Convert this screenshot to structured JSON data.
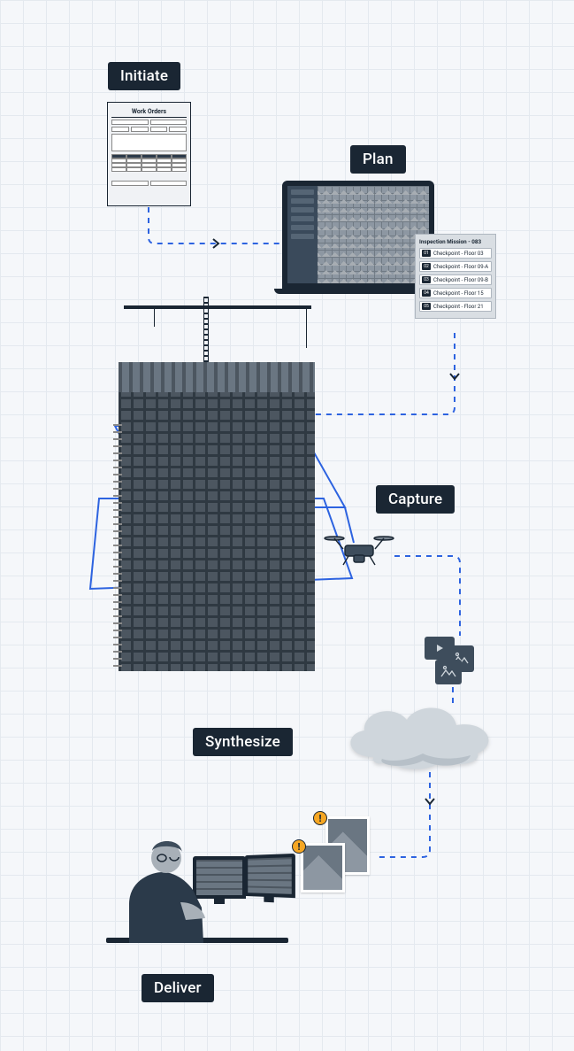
{
  "steps": {
    "initiate": "Initiate",
    "plan": "Plan",
    "capture": "Capture",
    "synthesize": "Synthesize",
    "deliver": "Deliver"
  },
  "workorder": {
    "title": "Work Orders"
  },
  "mission": {
    "title": "Inspection Mission - 083",
    "checkpoints": [
      {
        "num": "01",
        "label": "Checkpoint - Floor 03"
      },
      {
        "num": "02",
        "label": "Checkpoint - Floor 09-A"
      },
      {
        "num": "03",
        "label": "Checkpoint - Floor 09-B"
      },
      {
        "num": "04",
        "label": "Checkpoint - Floor 15"
      },
      {
        "num": "05",
        "label": "Checkpoint - Floor 21"
      }
    ]
  },
  "alert_glyph": "!"
}
